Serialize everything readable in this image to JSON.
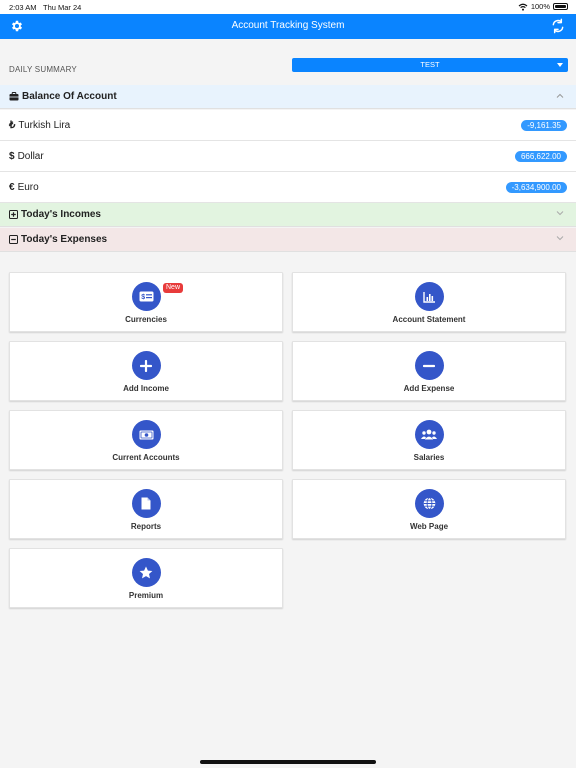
{
  "status": {
    "time": "2:03 AM",
    "date": "Thu Mar 24",
    "battery": "100%"
  },
  "header": {
    "title": "Account Tracking System",
    "settings_icon": "gear-icon",
    "refresh_icon": "refresh-icon"
  },
  "summary": {
    "label": "DAILY SUMMARY",
    "selected": "TEST"
  },
  "balance": {
    "title": "Balance Of Account",
    "rows": [
      {
        "symbol": "₺",
        "name": "Turkish Lira",
        "amount": "-9,161.35"
      },
      {
        "symbol": "$",
        "name": "Dollar",
        "amount": "666,622.00"
      },
      {
        "symbol": "€",
        "name": "Euro",
        "amount": "-3,634,900.00"
      }
    ]
  },
  "incomes": {
    "title": "Today's Incomes"
  },
  "expenses": {
    "title": "Today's Expenses"
  },
  "menu": [
    {
      "label": "Currencies",
      "icon": "currency-icon",
      "badge": "New"
    },
    {
      "label": "Account Statement",
      "icon": "chart-icon"
    },
    {
      "label": "Add Income",
      "icon": "plus-icon"
    },
    {
      "label": "Add Expense",
      "icon": "minus-icon"
    },
    {
      "label": "Current Accounts",
      "icon": "cash-icon"
    },
    {
      "label": "Salaries",
      "icon": "users-icon"
    },
    {
      "label": "Reports",
      "icon": "document-icon"
    },
    {
      "label": "Web Page",
      "icon": "globe-icon"
    },
    {
      "label": "Premium",
      "icon": "star-icon"
    }
  ],
  "colors": {
    "accent": "#0a84ff",
    "icon_circle": "#3456c9",
    "badge": "#3399ff",
    "new_badge": "#e83b3b"
  }
}
